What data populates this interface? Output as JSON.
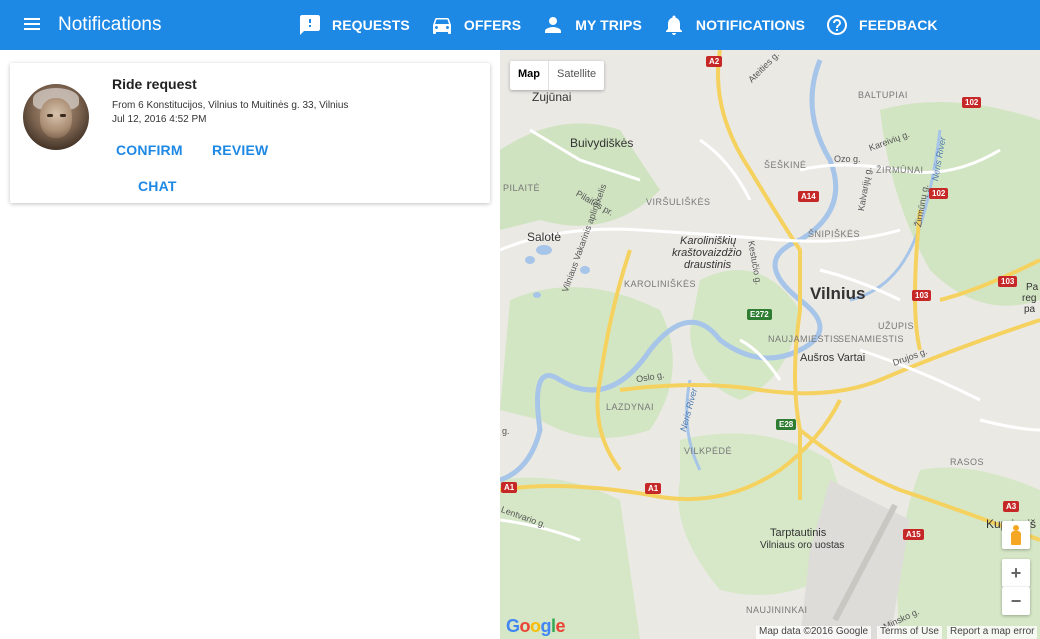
{
  "header": {
    "title": "Notifications",
    "nav": [
      {
        "label": "REQUESTS",
        "icon": "feedback-exclamation-icon"
      },
      {
        "label": "OFFERS",
        "icon": "car-icon"
      },
      {
        "label": "MY TRIPS",
        "icon": "person-icon"
      },
      {
        "label": "NOTIFICATIONS",
        "icon": "bell-icon"
      },
      {
        "label": "FEEDBACK",
        "icon": "help-circle-icon"
      }
    ],
    "accent_color": "#1e88e5"
  },
  "notification": {
    "title": "Ride request",
    "route": "From 6 Konstitucijos, Vilnius to Muitinės g. 33, Vilnius",
    "date": "Jul 12, 2016 4:52 PM",
    "actions": {
      "confirm": "CONFIRM",
      "review": "REVIEW",
      "chat": "CHAT"
    }
  },
  "map": {
    "type_controls": {
      "map": "Map",
      "satellite": "Satellite"
    },
    "labels": {
      "zujunai": "Zujūnai",
      "buivydiskes": "Buivydiškės",
      "pilaite": "PILAITĖ",
      "salote": "Salotė",
      "virsuliskes": "VIRŠULIŠKĖS",
      "karoliniskes": "KAROLINIŠKĖS",
      "park1": "Karoliniškių",
      "park2": "kraštovaizdžio",
      "park3": "draustinis",
      "vilnius": "Vilnius",
      "seskine": "ŠEŠKINĖ",
      "zirmunai": "ŽIRMŪNAI",
      "snipiskes": "ŠNIPIŠKĖS",
      "baltupiai": "BALTUPIAI",
      "senamiestis": "SENAMIESTIS",
      "naujamiestis": "NAUJAMIESTIS",
      "uzupis": "UŽUPIS",
      "ausros_vartai": "Aušros Vartai",
      "lazdynai": "LAZDYNAI",
      "vilkpede": "VILKPĖDĖ",
      "rasos": "RASOS",
      "tarptautinis1": "Tarptautinis",
      "tarptautinis2": "Vilniaus oro uostas",
      "naujininkai": "NAUJININKAI",
      "kuprioniskes": "Kuprioniš",
      "regional1": "Pa",
      "regional2": "reg",
      "regional3": "pa",
      "oslo": "Oslo g.",
      "vakarinis": "Vilniaus Vakarinis aplinkkelis",
      "neris": "Neris River",
      "neris2": "Neris River",
      "pilaites": "Pilaitės pr.",
      "ozo": "Ozo g.",
      "kareiviu": "Kareivių g.",
      "kalvariju": "Kalvarijų g.",
      "zirmunu": "Žirmūnų g.",
      "kestucio": "Kestučio g.",
      "drujos": "Drujos g.",
      "lentvario": "Lentvario g.",
      "ateities": "Ateities g.",
      "minsko": "Minsko g.",
      "road_n": "g."
    },
    "shields": [
      {
        "text": "A2",
        "color": "red"
      },
      {
        "text": "102",
        "color": "red"
      },
      {
        "text": "102",
        "color": "red"
      },
      {
        "text": "A14",
        "color": "red"
      },
      {
        "text": "103",
        "color": "red"
      },
      {
        "text": "103",
        "color": "red"
      },
      {
        "text": "E272",
        "color": "green"
      },
      {
        "text": "E28",
        "color": "green"
      },
      {
        "text": "A1",
        "color": "red"
      },
      {
        "text": "A1",
        "color": "red"
      },
      {
        "text": "A3",
        "color": "red"
      },
      {
        "text": "A15",
        "color": "red"
      }
    ],
    "zoom_in": "+",
    "zoom_out": "−",
    "google": "Google",
    "attribution": "Map data ©2016 Google",
    "terms": "Terms of Use",
    "report": "Report a map error"
  }
}
